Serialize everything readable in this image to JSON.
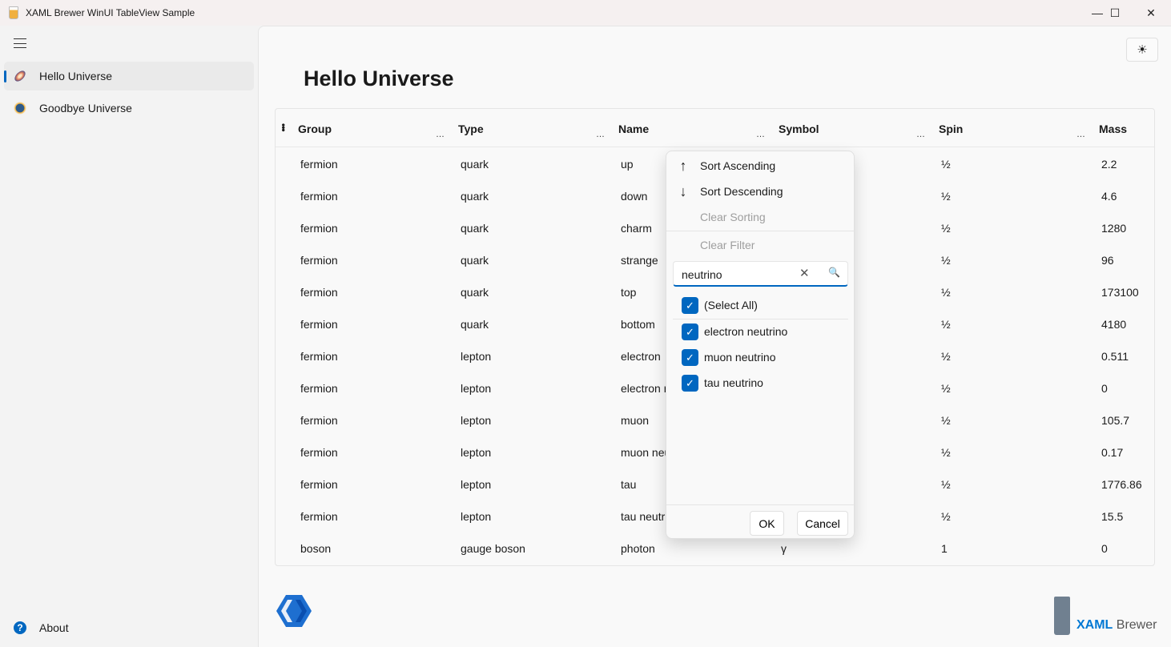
{
  "window": {
    "title": "XAML Brewer WinUI TableView Sample",
    "minimize": "—",
    "maximize": "☐",
    "close": "✕"
  },
  "sidebar": {
    "items": [
      {
        "label": "Hello Universe",
        "icon": "galaxy-icon",
        "selected": true
      },
      {
        "label": "Goodbye Universe",
        "icon": "planet-icon"
      }
    ],
    "footer": {
      "label": "About",
      "icon": "help-icon"
    }
  },
  "page": {
    "title": "Hello Universe",
    "theme_icon": "☀"
  },
  "table": {
    "columns": [
      "Group",
      "Type",
      "Name",
      "Symbol",
      "Spin",
      "Mass"
    ],
    "rows": [
      [
        "fermion",
        "quark",
        "up",
        "",
        "½",
        "2.2"
      ],
      [
        "fermion",
        "quark",
        "down",
        "",
        "½",
        "4.6"
      ],
      [
        "fermion",
        "quark",
        "charm",
        "",
        "½",
        "1280"
      ],
      [
        "fermion",
        "quark",
        "strange",
        "",
        "½",
        "96"
      ],
      [
        "fermion",
        "quark",
        "top",
        "",
        "½",
        "173100"
      ],
      [
        "fermion",
        "quark",
        "bottom",
        "",
        "½",
        "4180"
      ],
      [
        "fermion",
        "lepton",
        "electron",
        "",
        "½",
        "0.511"
      ],
      [
        "fermion",
        "lepton",
        "electron neutrino",
        "",
        "½",
        "0"
      ],
      [
        "fermion",
        "lepton",
        "muon",
        "",
        "½",
        "105.7"
      ],
      [
        "fermion",
        "lepton",
        "muon neutrino",
        "",
        "½",
        "0.17"
      ],
      [
        "fermion",
        "lepton",
        "tau",
        "",
        "½",
        "1776.86"
      ],
      [
        "fermion",
        "lepton",
        "tau neutrino",
        "",
        "½",
        "15.5"
      ],
      [
        "boson",
        "gauge boson",
        "photon",
        "γ",
        "1",
        "0"
      ]
    ]
  },
  "filter_menu": {
    "sort_ascending": "Sort Ascending",
    "sort_descending": "Sort Descending",
    "clear_sorting": "Clear Sorting",
    "clear_filter": "Clear Filter",
    "search_value": "neutrino",
    "select_all": "(Select All)",
    "options": [
      "electron neutrino",
      "muon neutrino",
      "tau neutrino"
    ],
    "ok": "OK",
    "cancel": "Cancel"
  },
  "branding": {
    "text_a": "XAML",
    "text_b": "Brewer"
  },
  "colors": {
    "accent": "#0067c0"
  }
}
